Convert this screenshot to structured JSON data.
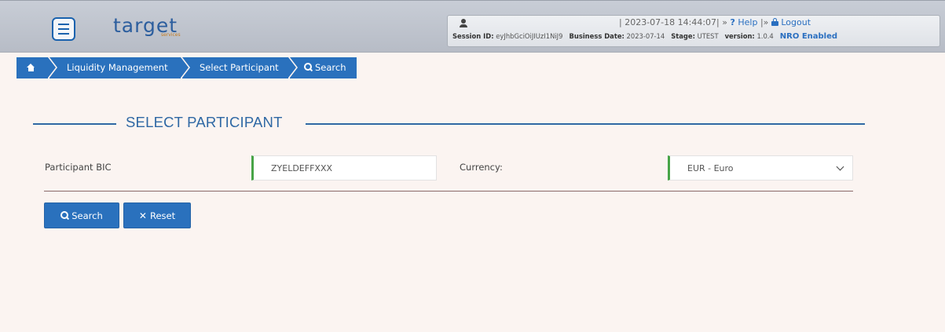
{
  "header": {
    "logo_text": "target",
    "logo_sub": "services",
    "timestamp": "| 2023-07-18 14:44:07| »",
    "help_label": "Help",
    "sep": "|»",
    "logout_label": "Logout",
    "session_label": "Session ID:",
    "session_value": "eyJhbGciOiJIUzI1NiJ9",
    "business_date_label": "Business Date:",
    "business_date_value": "2023-07-14",
    "stage_label": "Stage:",
    "stage_value": "UTEST",
    "version_label": "version:",
    "version_value": "1.0.4",
    "nro_label": "NRO Enabled"
  },
  "breadcrumb": {
    "items": [
      "Liquidity Management",
      "Select Participant",
      "Search"
    ]
  },
  "section": {
    "title": "SELECT PARTICIPANT"
  },
  "form": {
    "bic_label": "Participant BIC",
    "bic_value": "ZYELDEFFXXX",
    "currency_label": "Currency:",
    "currency_value": "EUR - Euro"
  },
  "buttons": {
    "search": "Search",
    "reset": "Reset"
  },
  "colors": {
    "primary": "#2a71bd",
    "accent_green": "#47a447",
    "section": "#2f68a4"
  }
}
